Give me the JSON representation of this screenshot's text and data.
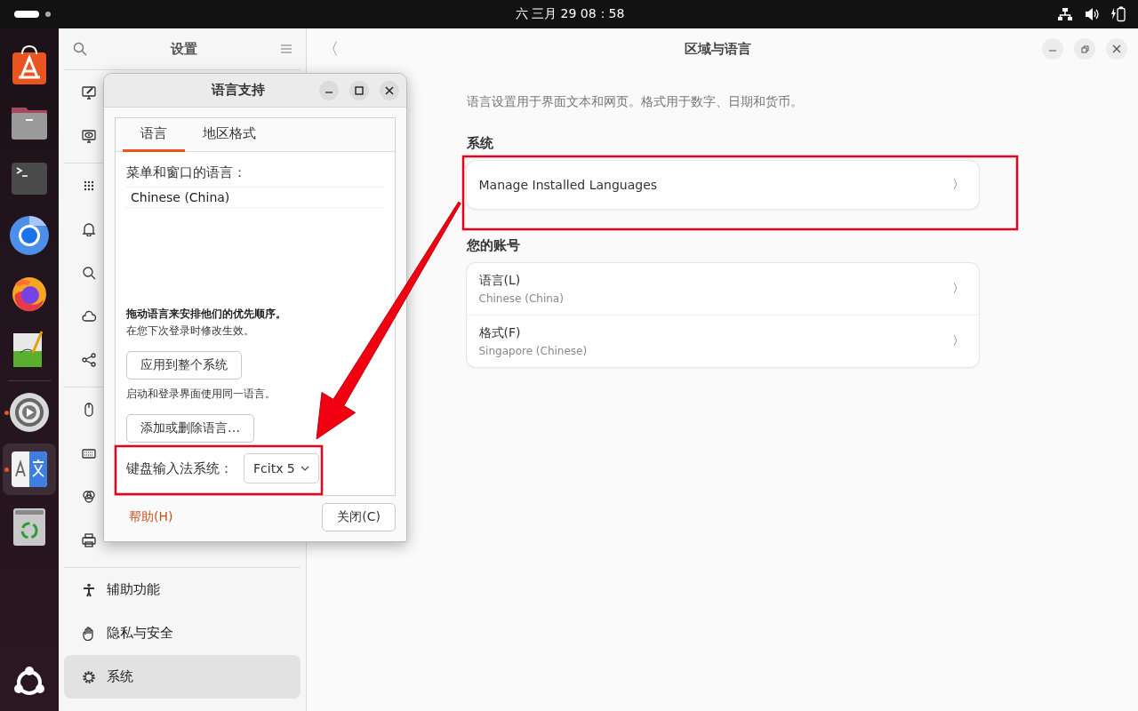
{
  "top_bar": {
    "clock": "六 三月 29  08：58"
  },
  "dock": {
    "apps": [
      {
        "running": false,
        "selected": false
      },
      {
        "running": false,
        "selected": false
      },
      {
        "running": false,
        "selected": false
      },
      {
        "running": false,
        "selected": false
      },
      {
        "running": false,
        "selected": false
      },
      {
        "running": false,
        "selected": false
      },
      {
        "running": true,
        "selected": false
      },
      {
        "running": true,
        "selected": true
      },
      {
        "running": false,
        "selected": false
      }
    ]
  },
  "sidebar": {
    "title": "设置",
    "groups": [
      [
        {
          "selected": false
        },
        {
          "selected": false
        }
      ],
      [
        {
          "selected": false
        },
        {
          "selected": false
        },
        {
          "selected": false
        },
        {
          "selected": false
        },
        {
          "selected": false
        }
      ],
      [
        {
          "selected": false
        },
        {
          "selected": false
        },
        {
          "selected": false
        },
        {
          "selected": false
        }
      ],
      [
        {
          "label": "辅助功能",
          "selected": false
        },
        {
          "label": "隐私与安全",
          "selected": false
        },
        {
          "label": "系统",
          "selected": true
        }
      ]
    ]
  },
  "main": {
    "back": "〈",
    "title": "区域与语言",
    "description": "语言设置用于界面文本和网页。格式用于数字、日期和货币。",
    "sections": [
      {
        "heading": "系统",
        "rows": [
          {
            "title": "Manage Installed Languages",
            "chevron": "〉"
          }
        ]
      },
      {
        "heading": "您的账号",
        "rows": [
          {
            "title": "语言(L)",
            "subtitle": "Chinese (China)",
            "chevron": "〉"
          },
          {
            "title": "格式(F)",
            "subtitle": "Singapore (Chinese)",
            "chevron": "〉"
          }
        ]
      }
    ]
  },
  "dialog": {
    "title": "语言支持",
    "tabs": [
      {
        "label": "语言",
        "selected": true
      },
      {
        "label": "地区格式",
        "selected": false
      }
    ],
    "languages_label": "菜单和窗口的语言：",
    "languages": [
      "Chinese (China)"
    ],
    "drag_hint": "拖动语言来安排他们的优先顺序。",
    "drag_note": "在您下次登录时修改生效。",
    "apply_button": "应用到整个系统",
    "apply_note": "启动和登录界面使用同一语言。",
    "add_button": "添加或删除语言…",
    "input_label": "键盘输入法系统：",
    "input_value": "Fcitx 5",
    "help_button": "帮助(H)",
    "close_button": "关闭(C)"
  },
  "annotations": [
    {
      "kind": "box"
    },
    {
      "kind": "box"
    },
    {
      "kind": "arrow"
    }
  ]
}
